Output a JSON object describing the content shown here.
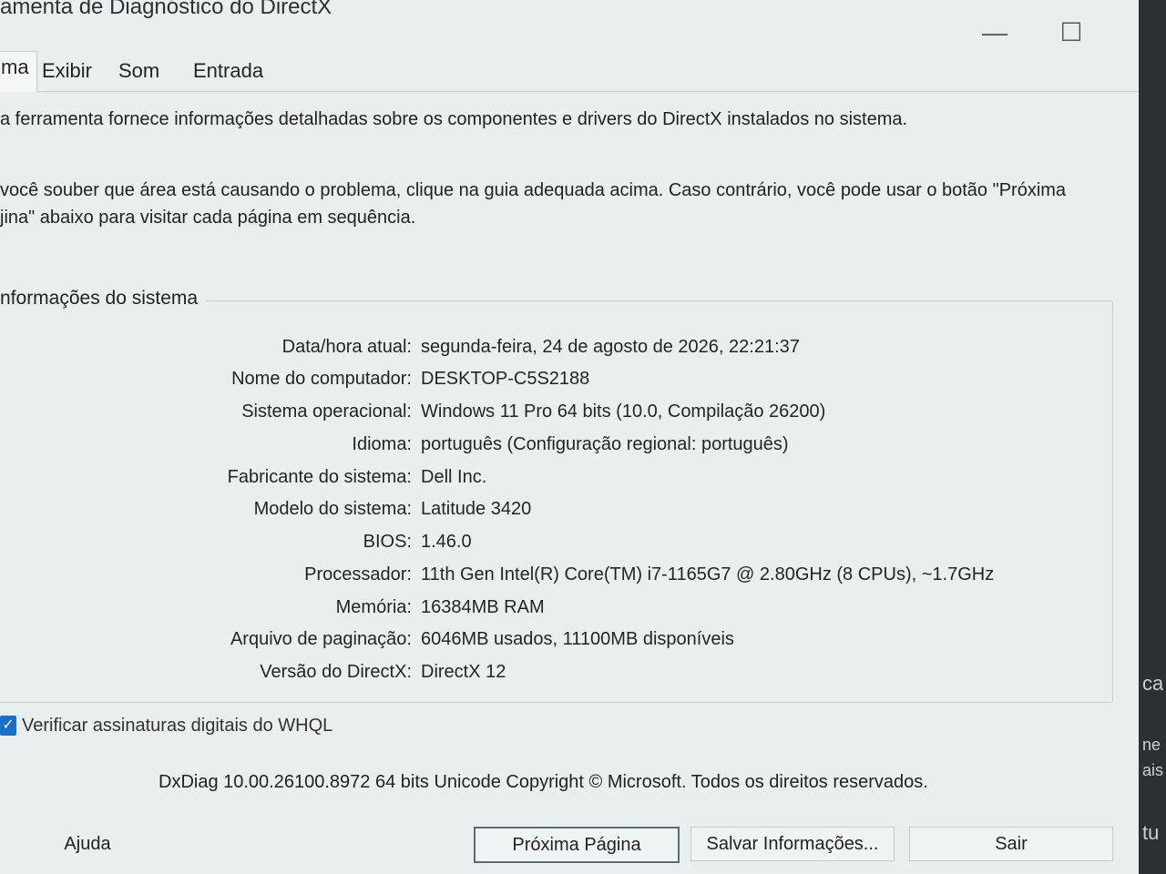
{
  "window": {
    "title": "ramenta de Diagnóstico do DirectX",
    "minimize_glyph": "—",
    "maximize_glyph": "☐",
    "close_glyph": "✕"
  },
  "tabs": [
    {
      "label": "ma",
      "active": true
    },
    {
      "label": "Exibir",
      "active": false
    },
    {
      "label": "Som",
      "active": false
    },
    {
      "label": "Entrada",
      "active": false
    }
  ],
  "intro": {
    "line1": "a ferramenta fornece informações detalhadas sobre os componentes e drivers do DirectX instalados no sistema.",
    "line2": "você souber que área está causando o problema, clique na guia adequada acima. Caso contrário, você pode usar o botão \"Próxima",
    "line3": "jina\" abaixo para visitar cada página em sequência."
  },
  "system_info": {
    "title": "nformações do sistema",
    "rows": [
      {
        "label": "Data/hora atual:",
        "value": "segunda-feira, 24 de agosto de 2026, 22:21:37"
      },
      {
        "label": "Nome do computador:",
        "value": "DESKTOP-C5S2188"
      },
      {
        "label": "Sistema operacional:",
        "value": "Windows 11 Pro 64 bits (10.0, Compilação 26200)"
      },
      {
        "label": "Idioma:",
        "value": "português (Configuração regional: português)"
      },
      {
        "label": "Fabricante do sistema:",
        "value": "Dell Inc."
      },
      {
        "label": "Modelo do sistema:",
        "value": "Latitude 3420"
      },
      {
        "label": "BIOS:",
        "value": "1.46.0"
      },
      {
        "label": "Processador:",
        "value": "11th Gen Intel(R) Core(TM) i7-1165G7 @ 2.80GHz (8 CPUs), ~1.7GHz"
      },
      {
        "label": "Memória:",
        "value": "16384MB RAM"
      },
      {
        "label": "Arquivo de paginação:",
        "value": "6046MB usados, 11100MB disponíveis"
      },
      {
        "label": "Versão do DirectX:",
        "value": "DirectX 12"
      }
    ]
  },
  "whql": {
    "label": "Verificar assinaturas digitais do WHQL",
    "checked": true,
    "check_glyph": "✓"
  },
  "footer": {
    "info": "DxDiag 10.00.26100.8972 64 bits Unicode  Copyright © Microsoft. Todos os direitos reservados."
  },
  "buttons": {
    "help": "Ajuda",
    "next": "Próxima Página",
    "save": "Salvar Informações...",
    "exit": "Sair"
  },
  "background_window": {
    "fragments": [
      "ca",
      "ne",
      "ais",
      "tu"
    ]
  }
}
